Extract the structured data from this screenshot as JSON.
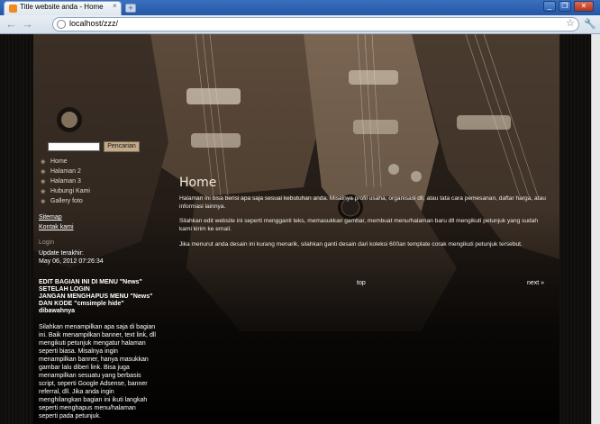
{
  "browser": {
    "tab_title": "Title website anda - Home",
    "tab_close": "×",
    "new_tab": "+",
    "back_icon": "back-arrow-icon",
    "forward_icon": "forward-arrow-icon",
    "url": "localhost/zzz/",
    "window_buttons": [
      "minimize",
      "restore",
      "close"
    ]
  },
  "sidebar": {
    "search_placeholder": "",
    "search_button": "Pencarian",
    "menu": [
      {
        "label": "Home"
      },
      {
        "label": "Halaman 2"
      },
      {
        "label": "Halaman 3"
      },
      {
        "label": "Hubungi Kami"
      },
      {
        "label": "Gallery foto"
      }
    ],
    "links": {
      "sitemap": "Sitemap",
      "contact": "Kontak kami"
    },
    "login": "Login",
    "update_label": "Update terakhir:",
    "update_date": "May 06, 2012 07:26:34",
    "edit_note": [
      "EDIT BAGIAN INI DI MENU \"News\"",
      "SETELAH LOGIN",
      "JANGAN MENGHAPUS MENU \"News\"",
      "DAN KODE \"cmsimple hide\"",
      "dibawahnya"
    ],
    "edit_desc": "Silahkan menampilkan apa saja di bagian ini. Baik menampilkan banner, text link, dll mengikuti petunjuk mengatur halaman seperti biasa. Misalnya ingin menampilkan banner, hanya masukkan gambar lalu diberi link. Bisa juga menampilkan sesuatu yang berbasis script, seperti Google Adsense, banner referral, dll. Jika anda ingin menghilangkan bagian ini ikuti langkah seperti menghapus menu/halaman seperti pada petunjuk."
  },
  "main": {
    "title": "Home",
    "paragraphs": [
      "Halaman ini bisa berisi apa saja sesuai kebutuhan anda. Misalnya profil usaha, organisasi dll, atau tata cara pemesanan, daftar harga, atau informasi lainnya.",
      "Silahkan edit website ini seperti mengganti teks, memasukkan gambar, membuat menu/halaman baru dll mengikuti petunjuk yang sudah kami kirim ke email.",
      "Jika menurut anda desain ini kurang menarik, silahkan ganti desain dari koleksi 600an template corak mengikuti petunjuk tersebut."
    ],
    "top_link": "top",
    "next_link": "next »"
  }
}
